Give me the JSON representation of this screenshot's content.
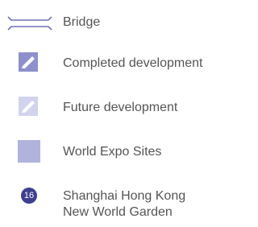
{
  "legend": {
    "items": [
      {
        "key": "bridge",
        "label": "Bridge",
        "symbol": "bridge-icon",
        "color": "#6e72b8"
      },
      {
        "key": "completed",
        "label": "Completed development",
        "symbol": "completed-development-icon",
        "color": "#8d90cc"
      },
      {
        "key": "future",
        "label": "Future development",
        "symbol": "future-development-icon",
        "color": "#d2d3ec"
      },
      {
        "key": "expo",
        "label": "World Expo Sites",
        "symbol": "world-expo-site-swatch",
        "color": "#b1b3dd"
      },
      {
        "key": "marker",
        "label_lines": [
          "Shanghai Hong Kong",
          "New World Garden"
        ],
        "marker_number": "16",
        "symbol": "numbered-marker-icon",
        "color": "#3d3f8f"
      }
    ]
  }
}
